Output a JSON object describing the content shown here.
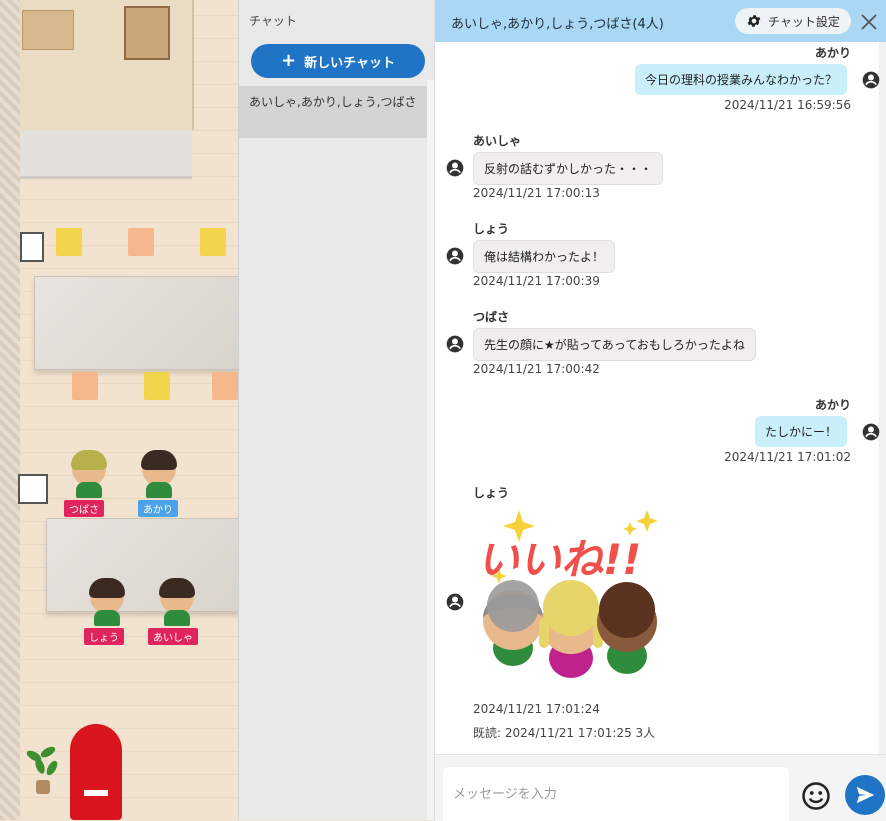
{
  "classroom": {
    "avatars": [
      {
        "label": "つばさ",
        "color": "#e0245e"
      },
      {
        "label": "あかり",
        "color": "#4aa3e8"
      },
      {
        "label": "しょう",
        "color": "#e0245e"
      },
      {
        "label": "あいしゃ",
        "color": "#e0245e"
      }
    ]
  },
  "chat_list": {
    "title": "チャット",
    "new_chat_label": "新しいチャット",
    "items": [
      {
        "label": "あいしゃ,あかり,しょう,つばさ"
      }
    ]
  },
  "conversation": {
    "header_title": "あいしゃ,あかり,しょう,つばさ(4人)",
    "settings_label": "チャット設定",
    "messages": [
      {
        "sender": "あかり",
        "text": "今日の理科の授業みんなわかった？",
        "time": "2024/11/21 16:59:56",
        "mine": true
      },
      {
        "sender": "あいしゃ",
        "text": "反射の話むずかしかった・・・",
        "time": "2024/11/21 17:00:13",
        "mine": false
      },
      {
        "sender": "しょう",
        "text": "俺は結構わかったよ！",
        "time": "2024/11/21 17:00:39",
        "mine": false
      },
      {
        "sender": "つばさ",
        "text": "先生の顔に★が貼ってあっておもしろかったよね",
        "time": "2024/11/21 17:00:42",
        "mine": false
      },
      {
        "sender": "あかり",
        "text": "たしかにー！",
        "time": "2024/11/21 17:01:02",
        "mine": true
      },
      {
        "sender": "しょう",
        "stamp_text": "いいね!!",
        "time": "2024/11/21 17:01:24",
        "read_receipt": "既読: 2024/11/21 17:01:25 3人",
        "mine": false
      }
    ]
  },
  "composer": {
    "placeholder": "メッセージを入力"
  },
  "colors": {
    "header_bg": "#a9d7f4",
    "accent": "#1f74c5",
    "my_bubble": "#c9f0fa",
    "other_bubble": "#f1eeee",
    "stamp_text": "#f0504a"
  }
}
